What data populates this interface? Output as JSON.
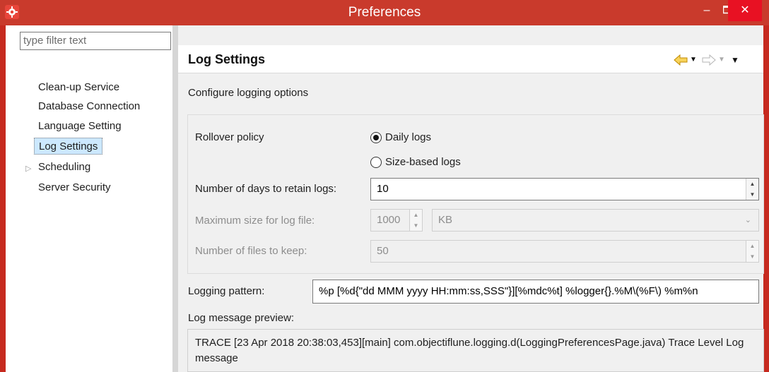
{
  "window": {
    "title": "Preferences",
    "accent": "#c93a2c",
    "close_color": "#e81123"
  },
  "sidebar": {
    "filter_placeholder": "type filter text",
    "items": [
      {
        "label": "Clean-up Service"
      },
      {
        "label": "Database Connection"
      },
      {
        "label": "Language Setting"
      },
      {
        "label": "Log Settings",
        "selected": true
      },
      {
        "label": "Scheduling",
        "expandable": true
      },
      {
        "label": "Server Security"
      }
    ]
  },
  "page": {
    "title": "Log Settings",
    "subtitle": "Configure logging options",
    "rollover": {
      "label": "Rollover policy",
      "options": [
        "Daily logs",
        "Size-based logs"
      ],
      "selected": "Daily logs"
    },
    "days": {
      "label": "Number of days to retain logs:",
      "value": "10"
    },
    "max_size": {
      "label": "Maximum size for log file:",
      "value": "1000",
      "unit": "KB"
    },
    "files_to_keep": {
      "label": "Number of files to keep:",
      "value": "50"
    },
    "pattern": {
      "label": "Logging pattern:",
      "value": "%p [%d{\"dd MMM yyyy HH:mm:ss,SSS\"}][%mdc%t] %logger{}.%M\\(%F\\) %m%n"
    },
    "preview": {
      "label": "Log message preview:",
      "text": "TRACE [23 Apr 2018 20:38:03,453][main] com.objectiflune.logging.d(LoggingPreferencesPage.java) Trace Level Log message"
    }
  },
  "icons": {
    "app": "preferences-app-icon",
    "back": "back-arrow-icon",
    "forward": "forward-arrow-icon",
    "menu": "view-menu-icon"
  }
}
